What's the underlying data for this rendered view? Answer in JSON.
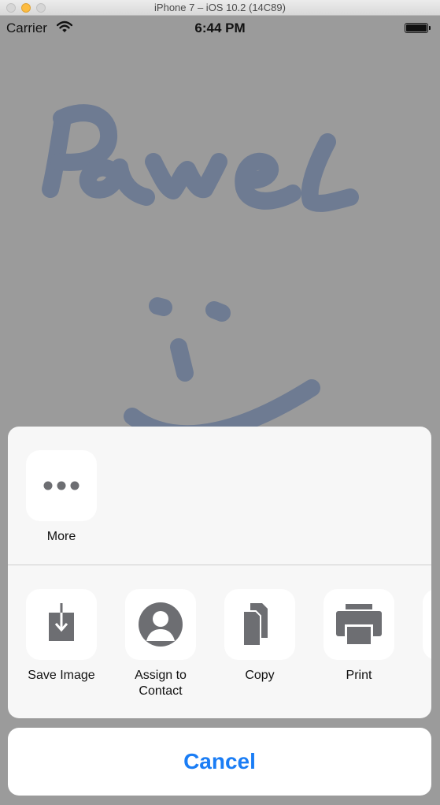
{
  "simulator": {
    "title": "iPhone 7 – iOS 10.2 (14C89)"
  },
  "status_bar": {
    "carrier": "Carrier",
    "time": "6:44 PM"
  },
  "canvas": {
    "stroke_color": "#6e7b92"
  },
  "share_sheet": {
    "top_row": [
      {
        "label": "More",
        "icon": "more-icon"
      }
    ],
    "actions": [
      {
        "label": "Save Image",
        "icon": "save-image-icon"
      },
      {
        "label": "Assign to\nContact",
        "icon": "contact-icon"
      },
      {
        "label": "Copy",
        "icon": "copy-icon"
      },
      {
        "label": "Print",
        "icon": "print-icon"
      }
    ],
    "cancel_label": "Cancel"
  },
  "colors": {
    "accent": "#1a7df5",
    "icon_gray": "#6d6e72"
  }
}
